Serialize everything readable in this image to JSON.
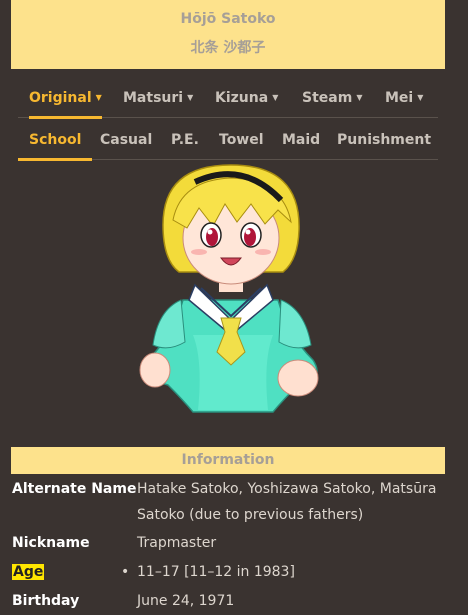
{
  "header": {
    "name_romaji": "Hōjō Satoko",
    "name_kanji": "北条 沙都子"
  },
  "tabs_row1": [
    {
      "label": "Original",
      "active": true
    },
    {
      "label": "Matsuri",
      "active": false
    },
    {
      "label": "Kizuna",
      "active": false
    },
    {
      "label": "Steam",
      "active": false
    },
    {
      "label": "Mei",
      "active": false
    }
  ],
  "tabs_row2": [
    {
      "label": "School",
      "active": true
    },
    {
      "label": "Casual",
      "active": false
    },
    {
      "label": "P.E.",
      "active": false
    },
    {
      "label": "Towel",
      "active": false
    },
    {
      "label": "Maid",
      "active": false
    },
    {
      "label": "Punishment",
      "active": false
    }
  ],
  "info": {
    "title": "Information",
    "rows": [
      {
        "key": "Alternate Name",
        "value": "Hatake Satoko, Yoshizawa Satoko, Matsūra Satoko (due to previous fathers)"
      },
      {
        "key": "Nickname",
        "value": "Trapmaster"
      },
      {
        "key": "Age",
        "value": "11–17 [11–12 in 1983]"
      },
      {
        "key": "Birthday",
        "value": "June 24, 1971"
      }
    ]
  },
  "colors": {
    "background": "#3a3330",
    "accent": "#f7b830",
    "header_bg": "#fde28c"
  }
}
